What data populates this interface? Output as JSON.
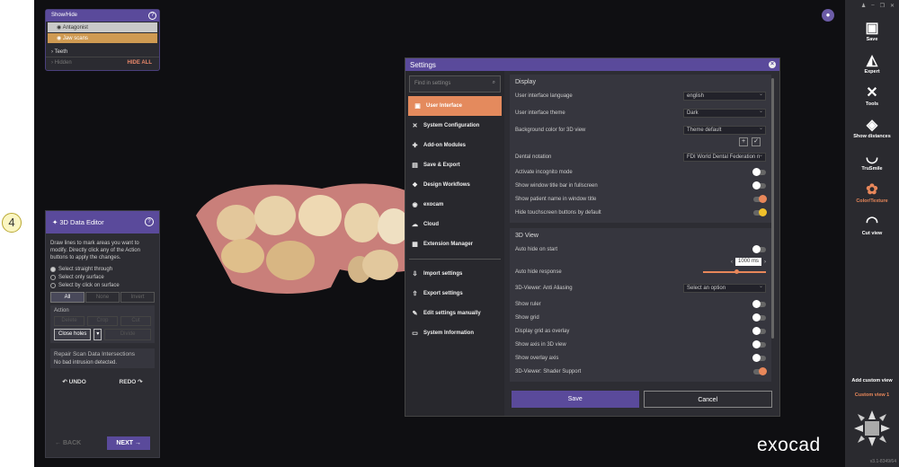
{
  "step_marker": "4",
  "brand": "exocad",
  "showhide": {
    "title": "Show/Hide",
    "items": [
      "Antagonist",
      "Jaw scans"
    ],
    "teeth": "Teeth",
    "hidden": "Hidden",
    "hide_all": "HIDE ALL"
  },
  "editor": {
    "title": "3D Data Editor",
    "description": "Draw lines to mark areas you want to modify. Directly click any of the Action buttons to apply the changes.",
    "options": [
      "Select straight through",
      "Select only surface",
      "Select by click on surface"
    ],
    "selection": [
      "All",
      "None",
      "Invert"
    ],
    "action_title": "Action",
    "actions": [
      "Delete",
      "Crop",
      "Cut"
    ],
    "close_holes": "Close holes",
    "divide": "Divide",
    "repair_title": "Repair Scan Data Intersections",
    "repair_status": "No bad intrusion detected.",
    "undo": "UNDO",
    "redo": "REDO",
    "back": "BACK",
    "next": "NEXT"
  },
  "settings": {
    "title": "Settings",
    "search_placeholder": "Find in settings",
    "menu": [
      "User Interface",
      "System Configuration",
      "Add-on Modules",
      "Save & Export",
      "Design Workflows",
      "exocam",
      "Cloud",
      "Extension Manager",
      "Import settings",
      "Export settings",
      "Edit settings manually",
      "System Information"
    ],
    "display": {
      "title": "Display",
      "language_label": "User interface language",
      "language": "english",
      "theme_label": "User interface theme",
      "theme": "Dark",
      "bg_label": "Background color for 3D view",
      "bg": "Theme default",
      "notation_label": "Dental notation",
      "notation": "FDI World Dental Federation n",
      "toggles": [
        {
          "label": "Activate incognito mode",
          "on": false
        },
        {
          "label": "Show window title bar in fullscreen",
          "on": false
        },
        {
          "label": "Show patient name in window title",
          "on": true
        },
        {
          "label": "Hide touchscreen buttons by default",
          "on": true
        }
      ]
    },
    "view3d": {
      "title": "3D View",
      "auto_hide_start": "Auto hide on start",
      "auto_hide_resp": "Auto hide response",
      "resp_value": "1000 ms",
      "aa_label": "3D-Viewer: Anti Aliasing",
      "aa_value": "Select an option",
      "toggles": [
        {
          "label": "Show ruler",
          "on": false
        },
        {
          "label": "Show grid",
          "on": false
        },
        {
          "label": "Display grid as overlay",
          "on": false
        },
        {
          "label": "Show axis in 3D view",
          "on": false
        },
        {
          "label": "Show overlay axis",
          "on": false
        },
        {
          "label": "3D-Viewer: Shader Support",
          "on": true
        }
      ]
    },
    "save": "Save",
    "cancel": "Cancel"
  },
  "sidebar": {
    "buttons": [
      "Save",
      "Expert",
      "Tools",
      "Show distances",
      "TruSmile",
      "Color/Texture",
      "Cut view"
    ],
    "add_custom": "Add custom view",
    "custom_view": "Custom view 1",
    "version": "v3.1-8349/64"
  },
  "colors": {
    "accent": "#5a4a9b",
    "highlight": "#e48a5d"
  }
}
